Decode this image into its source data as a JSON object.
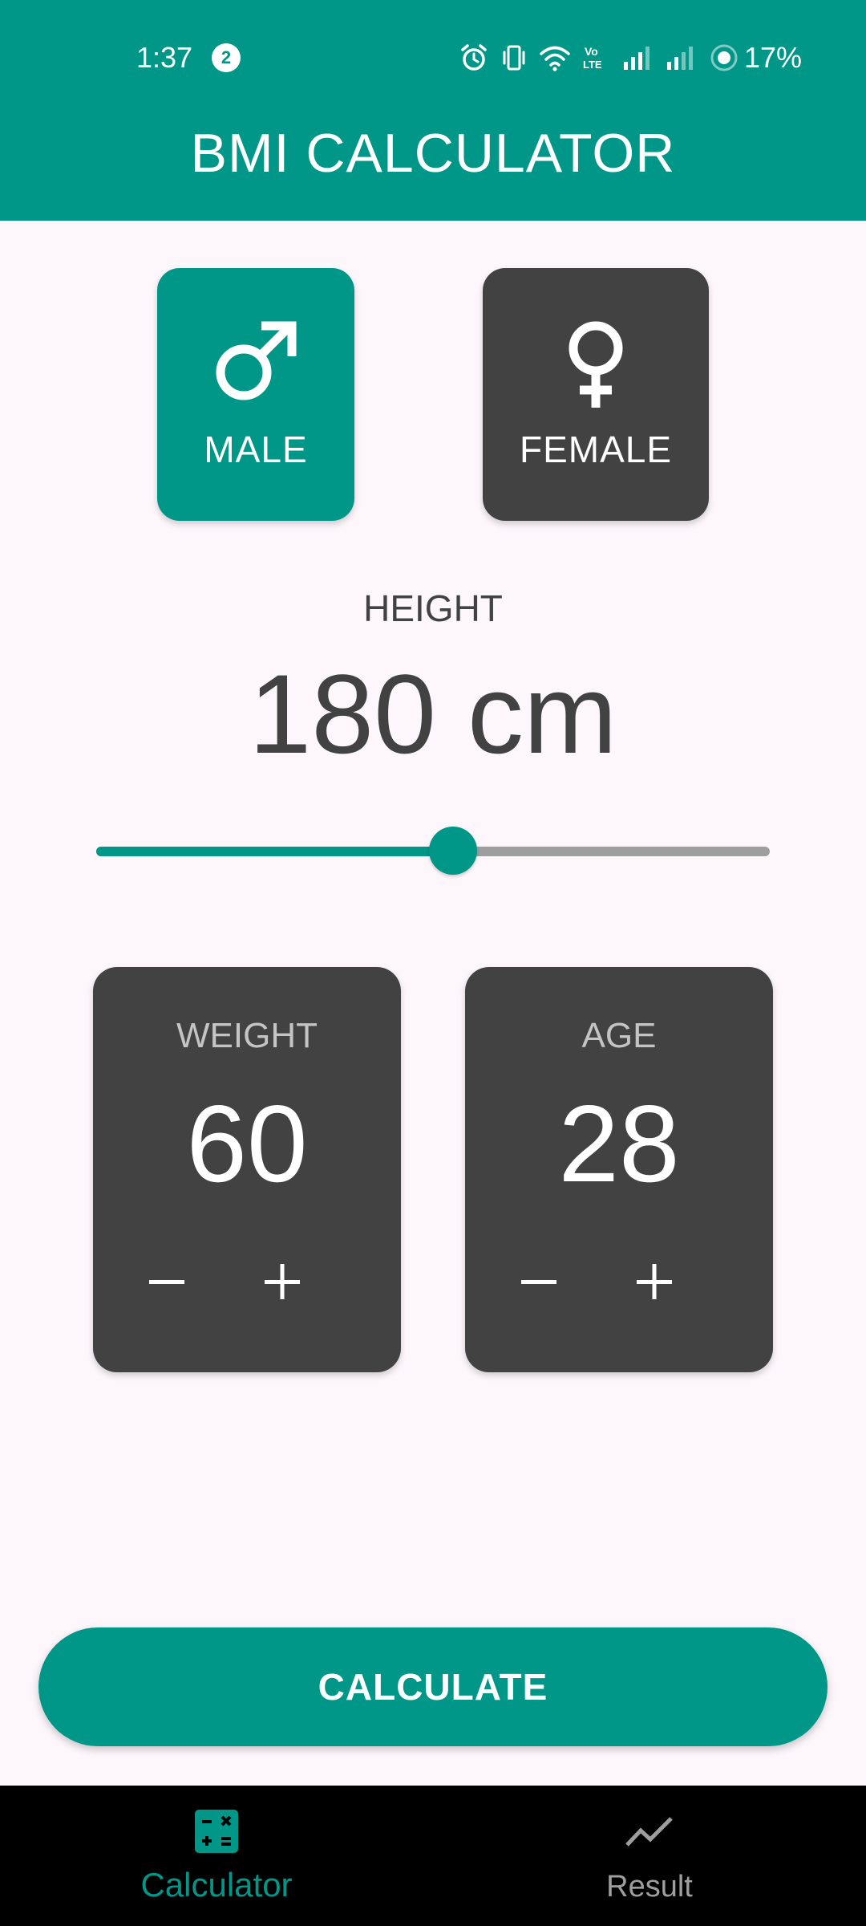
{
  "status_bar": {
    "time": "1:37",
    "notification_count": "2",
    "battery": "17%"
  },
  "app_bar": {
    "title": "BMI CALCULATOR"
  },
  "gender": {
    "male_label": "MALE",
    "female_label": "FEMALE",
    "selected": "MALE"
  },
  "height": {
    "label": "HEIGHT",
    "display": "180 cm",
    "slider_fraction": 0.53
  },
  "weight": {
    "label": "WEIGHT",
    "value": "60",
    "minus_symbol": "−",
    "plus_symbol": "+"
  },
  "age": {
    "label": "AGE",
    "value": "28",
    "minus_symbol": "−",
    "plus_symbol": "+"
  },
  "calculate_button": {
    "label": "CALCULATE"
  },
  "bottom_nav": {
    "items": [
      {
        "label": "Calculator",
        "icon": "calculator-icon",
        "active": true
      },
      {
        "label": "Result",
        "icon": "trending-line-icon",
        "active": false
      }
    ]
  },
  "colors": {
    "primary": "#009688",
    "card_dark": "#424242",
    "background": "#fdf7fc",
    "nav_background": "#000000",
    "nav_inactive": "#9e9e9e"
  },
  "icons": {
    "male": "male-symbol-icon",
    "female": "female-symbol-icon",
    "alarm": "alarm-icon",
    "vibrate": "vibrate-icon",
    "wifi": "wifi-icon",
    "volte": "volte-icon",
    "signal": "signal-icon",
    "battery": "battery-ring-icon"
  }
}
